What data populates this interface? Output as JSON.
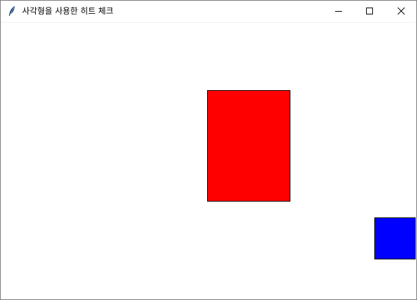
{
  "window": {
    "title": "사각형을 사용한 히트 체크",
    "icon": "feather-icon"
  },
  "controls": {
    "minimize_icon": "minimize-icon",
    "maximize_icon": "maximize-icon",
    "close_icon": "close-icon"
  },
  "canvas": {
    "background": "#ffffff",
    "rectangles": [
      {
        "name": "red-rectangle",
        "fill": "#ff0000",
        "outline": "#000000"
      },
      {
        "name": "blue-rectangle",
        "fill": "#0000ff",
        "outline": "#000000"
      }
    ]
  }
}
